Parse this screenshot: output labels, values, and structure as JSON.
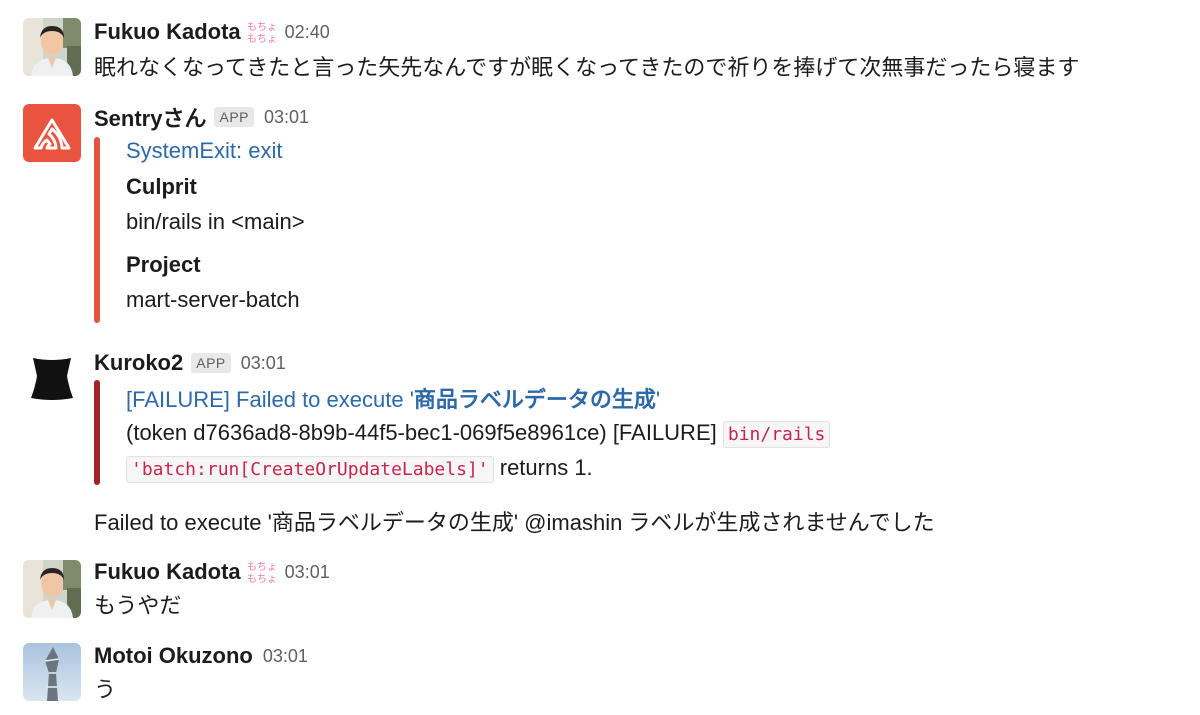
{
  "messages": {
    "m1": {
      "author": "Fukuo Kadota",
      "status_emoji_text": "もちょ もちょ",
      "time": "02:40",
      "text": "眠れなくなってきたと言った矢先なんですが眠くなってきたので祈りを捧げて次無事だったら寝ます"
    },
    "m2": {
      "author": "Sentryさん",
      "badge": "APP",
      "time": "03:01",
      "attachment": {
        "color": "#e05440",
        "title": "SystemExit: exit",
        "field1_title": "Culprit",
        "field1_value": "bin/rails in <main>",
        "field2_title": "Project",
        "field2_value": "mart-server-batch"
      }
    },
    "m3": {
      "author": "Kuroko2",
      "badge": "APP",
      "time": "03:01",
      "attachment": {
        "color": "#a12424",
        "title_prefix": "[FAILURE] Failed to execute '",
        "title_bold": "商品ラベルデータの生成",
        "title_suffix": "'",
        "line1_text": "(token d7636ad8-8b9b-44f5-bec1-069f5e8961ce) [FAILURE] ",
        "code1": "bin/rails",
        "code2": "'batch:run[CreateOrUpdateLabels]'",
        "line2_suffix": " returns 1."
      },
      "followup": "Failed to execute '商品ラベルデータの生成' @imashin ラベルが生成されませんでした"
    },
    "m4": {
      "author": "Fukuo Kadota",
      "status_emoji_text": "もちょ もちょ",
      "time": "03:01",
      "text": "もうやだ"
    },
    "m5": {
      "author": "Motoi Okuzono",
      "time": "03:01",
      "text": "う"
    }
  },
  "icons": {
    "sentry": "sentry-logo-icon",
    "kuroko": "kuroko-icon",
    "mochi": "mochi-status-emoji-icon"
  },
  "colors": {
    "link": "#2d69a9",
    "code": "#c7254e",
    "sentry_bg": "#e8543f"
  }
}
